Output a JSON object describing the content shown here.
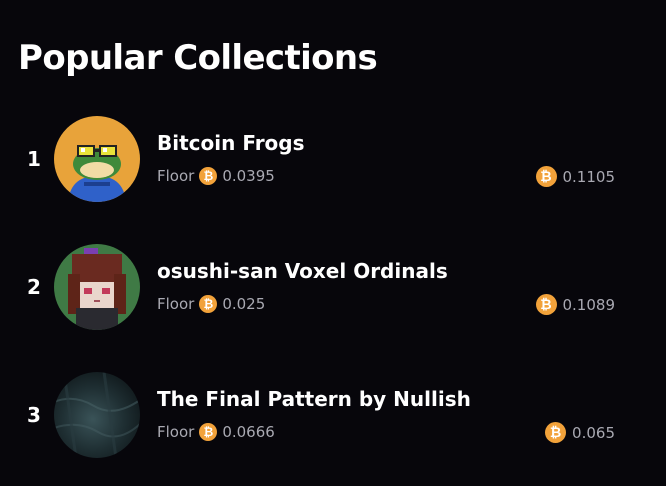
{
  "header": {
    "title": "Popular Collections"
  },
  "collections": [
    {
      "rank": "1",
      "name": "Bitcoin Frogs",
      "floor_label": "Floor",
      "floor": "0.0395",
      "volume": "0.1105",
      "avatar_icon": "frog-avatar-icon"
    },
    {
      "rank": "2",
      "name": "osushi-san Voxel Ordinals",
      "floor_label": "Floor",
      "floor": "0.025",
      "volume": "0.1089",
      "avatar_icon": "voxel-girl-avatar-icon"
    },
    {
      "rank": "3",
      "name": "The Final Pattern by Nullish",
      "floor_label": "Floor",
      "floor": "0.0666",
      "volume": "0.065",
      "avatar_icon": "dark-pattern-avatar-icon"
    }
  ],
  "currency": {
    "symbol": "₿",
    "color": "#f2a23a",
    "icon": "bitcoin-icon"
  }
}
